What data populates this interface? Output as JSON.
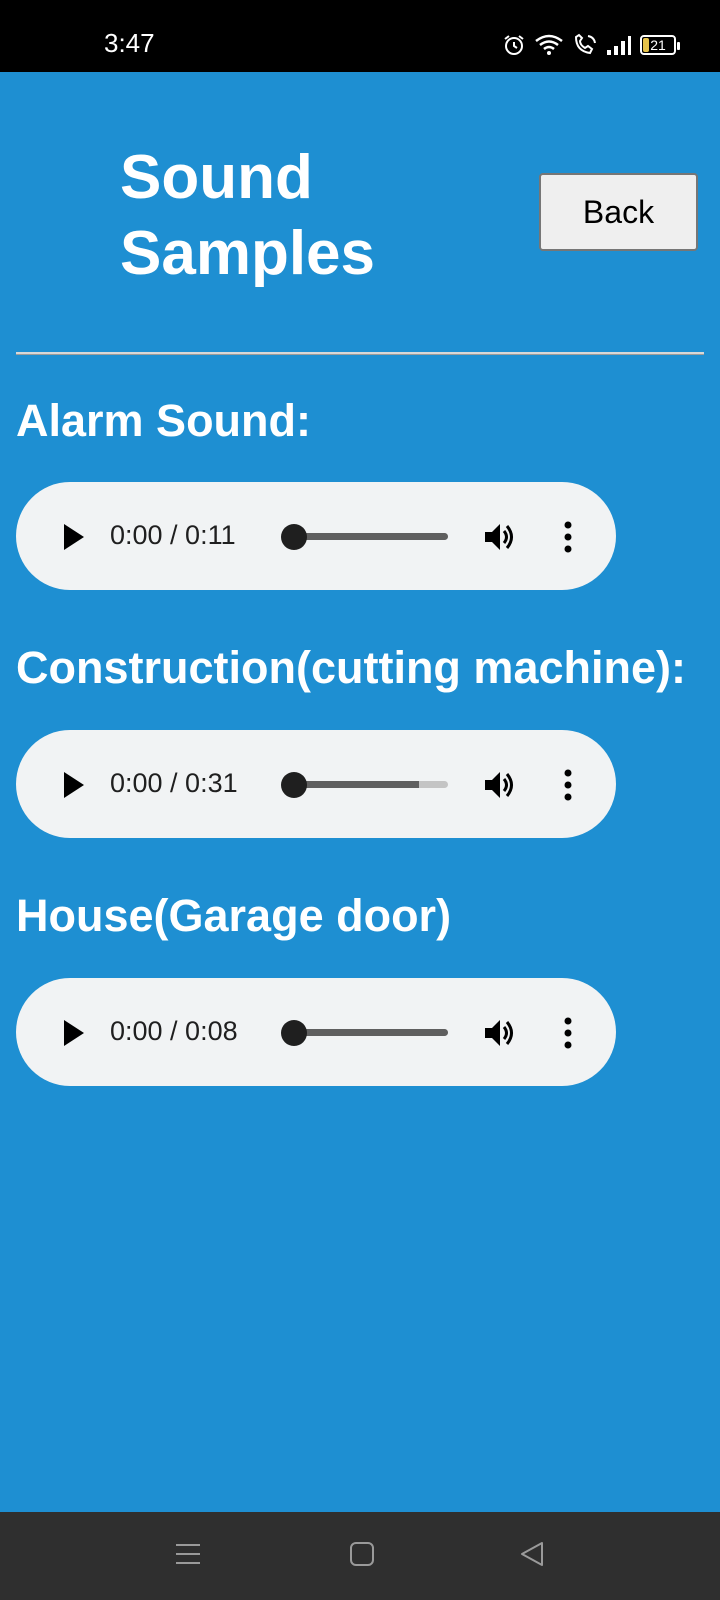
{
  "status_bar": {
    "time": "3:47",
    "battery_level": "21",
    "icons": [
      "alarm-icon",
      "wifi-icon",
      "wifi-calling-icon",
      "signal-icon",
      "battery-icon"
    ]
  },
  "header": {
    "title": "Sound Samples",
    "back_label": "Back"
  },
  "sections": [
    {
      "label": "Alarm Sound:",
      "player": {
        "time": "0:00 / 0:11",
        "buffered": 1.0
      }
    },
    {
      "label": "Construction(cutting machine):",
      "player": {
        "time": "0:00 / 0:31",
        "buffered": 0.82
      }
    },
    {
      "label": "House(Garage door)",
      "player": {
        "time": "0:00 / 0:08",
        "buffered": 1.0
      }
    }
  ],
  "nav_bar": {
    "icons": [
      "menu-icon",
      "home-icon",
      "back-triangle-icon"
    ]
  },
  "colors": {
    "background": "#1e8fd2",
    "player_bg": "#f1f3f4",
    "status_bar": "#000000",
    "nav_bar": "#2f2f2f"
  }
}
